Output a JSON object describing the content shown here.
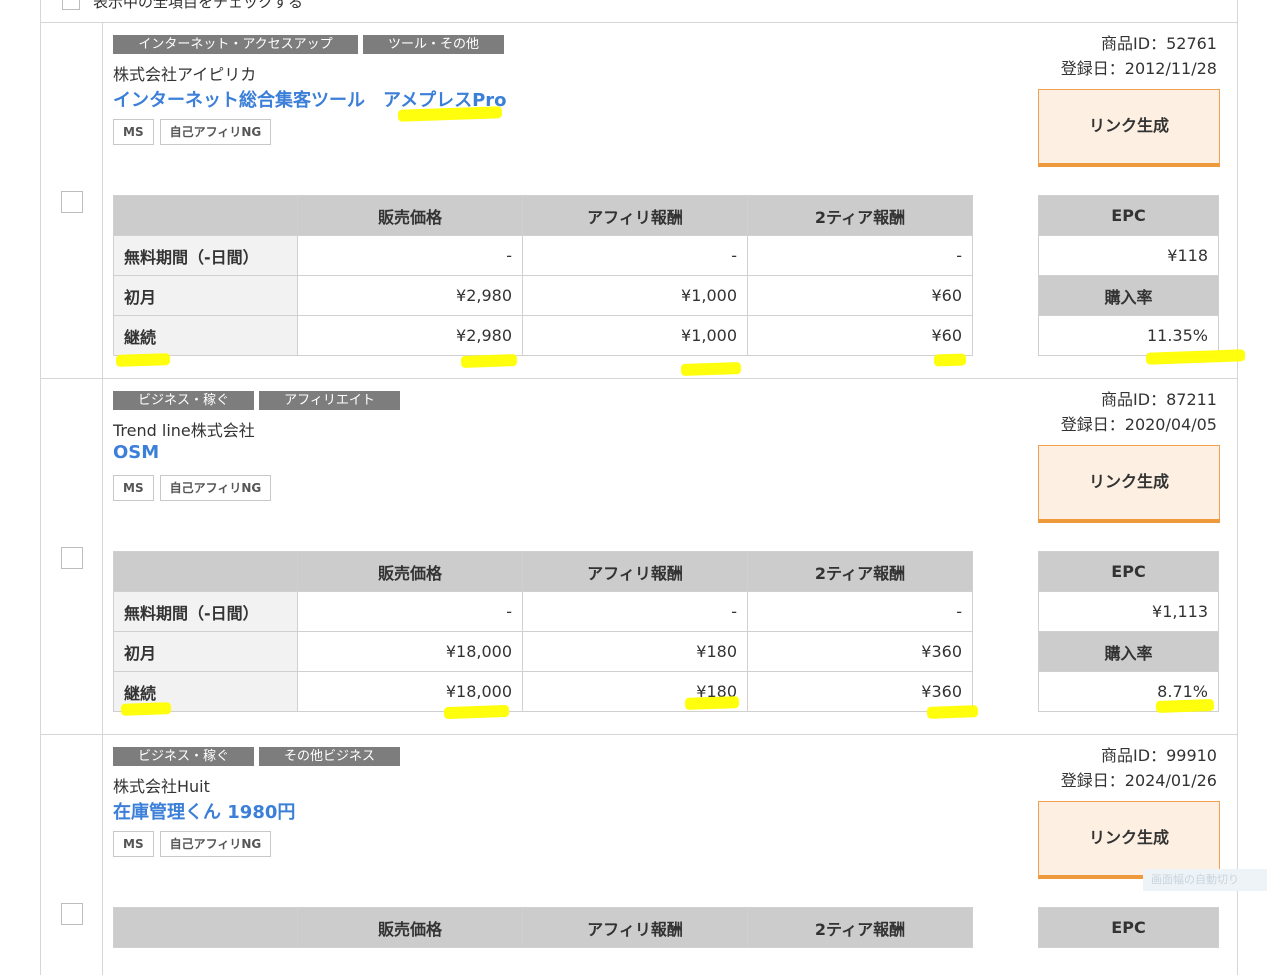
{
  "top_bar": {
    "select_all_label": "表示中の全項目をチェックする"
  },
  "headers": {
    "label_col": "",
    "price": "販売価格",
    "affiliate": "アフィリ報酬",
    "tier2": "2ティア報酬",
    "epc": "EPC",
    "purchase_rate": "購入率"
  },
  "link_button_label": "リンク生成",
  "products": [
    {
      "tags": [
        "インターネット・アクセスアップ",
        "ツール・その他"
      ],
      "company": "株式会社アイピリカ",
      "name": "インターネット総合集客ツール　アメプレスPro",
      "badges": [
        "MS",
        "自己アフィリNG"
      ],
      "product_id": "商品ID：52761",
      "registered": "登録日：2012/11/28",
      "rows": [
        {
          "label": "無料期間（-日間）",
          "price": "-",
          "affiliate": "-",
          "tier2": "-"
        },
        {
          "label": "初月",
          "price": "¥2,980",
          "affiliate": "¥1,000",
          "tier2": "¥60"
        },
        {
          "label": "継続",
          "price": "¥2,980",
          "affiliate": "¥1,000",
          "tier2": "¥60"
        }
      ],
      "epc": "¥118",
      "purchase_rate": "11.35%"
    },
    {
      "tags": [
        "ビジネス・稼ぐ",
        "アフィリエイト"
      ],
      "company": "Trend line株式会社",
      "name": "OSM",
      "badges": [
        "MS",
        "自己アフィリNG"
      ],
      "product_id": "商品ID：87211",
      "registered": "登録日：2020/04/05",
      "rows": [
        {
          "label": "無料期間（-日間）",
          "price": "-",
          "affiliate": "-",
          "tier2": "-"
        },
        {
          "label": "初月",
          "price": "¥18,000",
          "affiliate": "¥180",
          "tier2": "¥360"
        },
        {
          "label": "継続",
          "price": "¥18,000",
          "affiliate": "¥180",
          "tier2": "¥360"
        }
      ],
      "epc": "¥1,113",
      "purchase_rate": "8.71%"
    },
    {
      "tags": [
        "ビジネス・稼ぐ",
        "その他ビジネス"
      ],
      "company": "株式会社Huit",
      "name": "在庫管理くん 1980円",
      "badges": [
        "MS",
        "自己アフィリNG"
      ],
      "product_id": "商品ID：99910",
      "registered": "登録日：2024/01/26"
    }
  ],
  "float_tip": "画面幅の自動切り",
  "highlight_color": "#ffff00",
  "accent_color": "#3b7fd8"
}
